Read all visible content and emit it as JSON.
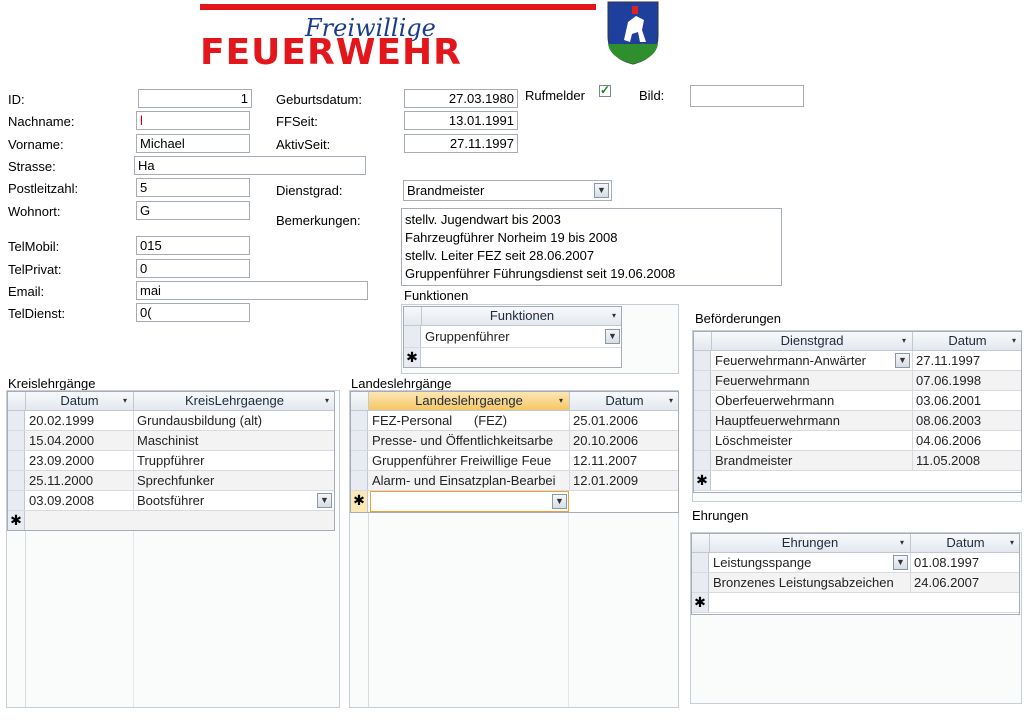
{
  "logo": {
    "line1": "Freiwillige",
    "line2": "FEUERWEHR"
  },
  "fields": {
    "id": {
      "label": "ID:",
      "value": "1"
    },
    "nachname": {
      "label": "Nachname:",
      "value": "l"
    },
    "vorname": {
      "label": "Vorname:",
      "value": "Michael"
    },
    "strasse": {
      "label": "Strasse:",
      "value": "Ha"
    },
    "plz": {
      "label": "Postleitzahl:",
      "value": "5"
    },
    "wohnort": {
      "label": "Wohnort:",
      "value": "G"
    },
    "telmobil": {
      "label": "TelMobil:",
      "value": "015"
    },
    "telprivat": {
      "label": "TelPrivat:",
      "value": "0"
    },
    "email": {
      "label": "Email:",
      "value": "mai"
    },
    "teldienst": {
      "label": "TelDienst:",
      "value": "0("
    },
    "geburtsdatum": {
      "label": "Geburtsdatum:",
      "value": "27.03.1980"
    },
    "ffseit": {
      "label": "FFSeit:",
      "value": "13.01.1991"
    },
    "aktivseit": {
      "label": "AktivSeit:",
      "value": "27.11.1997"
    },
    "rufmelder": {
      "label": "Rufmelder",
      "checked": true
    },
    "bild": {
      "label": "Bild:",
      "value": ""
    },
    "dienstgrad": {
      "label": "Dienstgrad:",
      "value": "Brandmeister"
    },
    "bemerkungen": {
      "label": "Bemerkungen:",
      "lines": [
        "stellv. Jugendwart bis 2003",
        "Fahrzeugführer Norheim 19 bis 2008",
        "stellv. Leiter FEZ seit 28.06.2007",
        "Gruppenführer Führungsdienst seit 19.06.2008"
      ]
    }
  },
  "funktionen": {
    "title": "Funktionen",
    "header": "Funktionen",
    "rows": [
      "Gruppenführer"
    ]
  },
  "kreis": {
    "title": "Kreislehrgänge",
    "headers": [
      "Datum",
      "KreisLehrgaenge"
    ],
    "rows": [
      [
        "20.02.1999",
        "Grundausbildung (alt)"
      ],
      [
        "15.04.2000",
        "Maschinist"
      ],
      [
        "23.09.2000",
        "Truppführer"
      ],
      [
        "25.11.2000",
        "Sprechfunker"
      ],
      [
        "03.09.2008",
        "Bootsführer"
      ]
    ]
  },
  "landes": {
    "title": "Landeslehrgänge",
    "headers": [
      "Landeslehrgaenge",
      "Datum"
    ],
    "rows": [
      [
        "FEZ-Personal      (FEZ)",
        "25.01.2006"
      ],
      [
        "Presse- und Öffentlichkeitsarbe",
        "20.10.2006"
      ],
      [
        "Gruppenführer Freiwillige Feue",
        "12.11.2007"
      ],
      [
        "Alarm- und Einsatzplan-Bearbei",
        "12.01.2009"
      ]
    ]
  },
  "befoerderungen": {
    "title": "Beförderungen",
    "headers": [
      "Dienstgrad",
      "Datum"
    ],
    "rows": [
      [
        "Feuerwehrmann-Anwärter",
        "27.11.1997"
      ],
      [
        "Feuerwehrmann",
        "07.06.1998"
      ],
      [
        "Oberfeuerwehrmann",
        "03.06.2001"
      ],
      [
        "Hauptfeuerwehrmann",
        "08.06.2003"
      ],
      [
        "Löschmeister",
        "04.06.2006"
      ],
      [
        "Brandmeister",
        "11.05.2008"
      ]
    ]
  },
  "ehrungen": {
    "title": "Ehrungen",
    "headers": [
      "Ehrungen",
      "Datum"
    ],
    "rows": [
      [
        "Leistungsspange",
        "01.08.1997"
      ],
      [
        "Bronzenes Leistungsabzeichen",
        "24.06.2007"
      ]
    ]
  },
  "symbols": {
    "new_row": "✱",
    "combo": "▼",
    "sort": "▾",
    "check": "✓"
  },
  "colors": {
    "logo_red": "#e3161b",
    "logo_blue": "#1a3c8c",
    "header_sel": "#f5c765"
  }
}
